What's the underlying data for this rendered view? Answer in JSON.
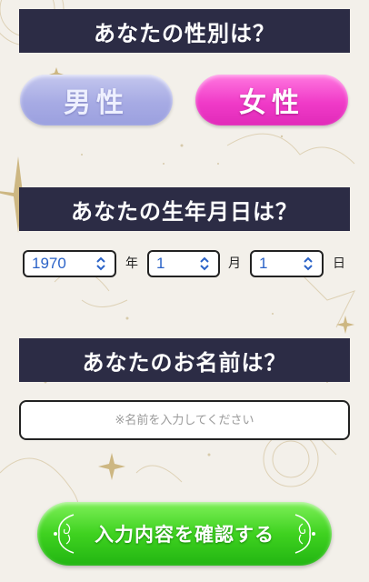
{
  "gender": {
    "heading": "あなたの性別は？",
    "male_label": "男性",
    "female_label": "女性"
  },
  "birthday": {
    "heading": "あなたの生年月日は？",
    "year_value": "1970",
    "year_unit": "年",
    "month_value": "1",
    "month_unit": "月",
    "day_value": "1",
    "day_unit": "日"
  },
  "name": {
    "heading": "あなたのお名前は？",
    "placeholder": "※名前を入力してください",
    "value": ""
  },
  "confirm": {
    "label": "入力内容を確認する"
  },
  "colors": {
    "banner": "#2c2c45",
    "male_pill": "#a7abe4",
    "female_pill": "#f03bc8",
    "confirm_button": "#3fd220",
    "select_text": "#2b63c8"
  }
}
